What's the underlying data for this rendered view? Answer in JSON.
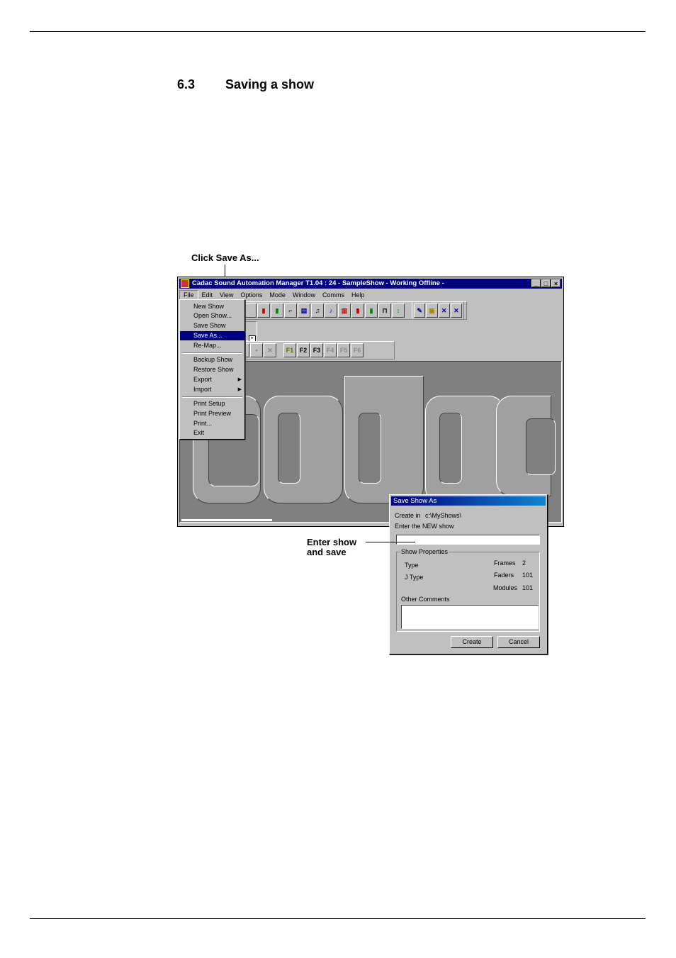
{
  "section": {
    "number": "6.3",
    "title": "Saving a show"
  },
  "callouts": {
    "save_as": "Click Save As...",
    "enter_line1": "Enter show",
    "enter_line2": "and save"
  },
  "app": {
    "title": "Cadac Sound Automation Manager T1.04 : 24 - SampleShow    - Working Offline -",
    "menu": [
      "File",
      "Edit",
      "View",
      "Options",
      "Mode",
      "Window",
      "Comms",
      "Help"
    ],
    "window_buttons": [
      "_",
      "□",
      "×"
    ],
    "toolbar_labels": [
      "F1",
      "F2",
      "F3",
      "F4",
      "F5",
      "F6"
    ],
    "logo_text": "Cadac"
  },
  "file_menu": {
    "items": [
      "New Show",
      "Open Show...",
      "Save Show",
      "Save As...",
      "Re-Map...",
      "Backup Show",
      "Restore Show",
      "Export",
      "Import",
      "Print Setup",
      "Print Preview",
      "Print...",
      "Exit"
    ],
    "selected": "Save As..."
  },
  "dialog": {
    "title": "Save Show As",
    "create_in_label": "Create in",
    "create_in_value": "c:\\MyShows\\",
    "prompt": "Enter the NEW show",
    "group_label": "Show Properties",
    "type_label": "Type",
    "jtype_label": "J Type",
    "frames_label": "Frames",
    "frames_value": "2",
    "faders_label": "Faders",
    "faders_value": "101",
    "modules_label": "Modules",
    "modules_value": "101",
    "comments_label": "Other Comments",
    "create_button": "Create",
    "cancel_button": "Cancel"
  },
  "colors": {
    "title_bar": "#000080",
    "window_bg": "#c0c0c0",
    "canvas_bg": "#808080"
  }
}
